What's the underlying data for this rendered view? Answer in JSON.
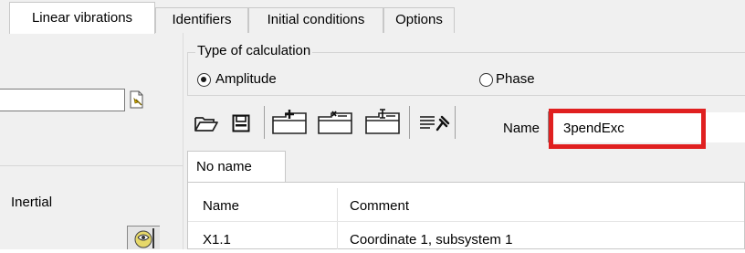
{
  "tabs": [
    {
      "label": "Linear vibrations",
      "active": true
    },
    {
      "label": "Identifiers",
      "active": false
    },
    {
      "label": "Initial conditions",
      "active": false
    },
    {
      "label": "Options",
      "active": false
    }
  ],
  "left_panel": {
    "input_value": "",
    "inertial_label": "Inertial"
  },
  "calculation": {
    "group_title": "Type of calculation",
    "options": [
      {
        "label": "Amplitude",
        "selected": true
      },
      {
        "label": "Phase",
        "selected": false
      }
    ]
  },
  "toolbar": {
    "icons": [
      "open-folder-icon",
      "save-icon",
      "add-item-icon",
      "delete-item-icon",
      "edit-item-icon",
      "list-pin-icon"
    ],
    "name_label": "Name",
    "name_value": "3pendExc"
  },
  "sub_tab": {
    "label": "No name"
  },
  "table": {
    "columns": [
      "Name",
      "Comment"
    ],
    "rows": [
      {
        "name": "X1.1",
        "comment": "Coordinate 1, subsystem 1"
      }
    ]
  },
  "colors": {
    "highlight": "#e02020",
    "tab_bg": "#f0f0f0"
  }
}
